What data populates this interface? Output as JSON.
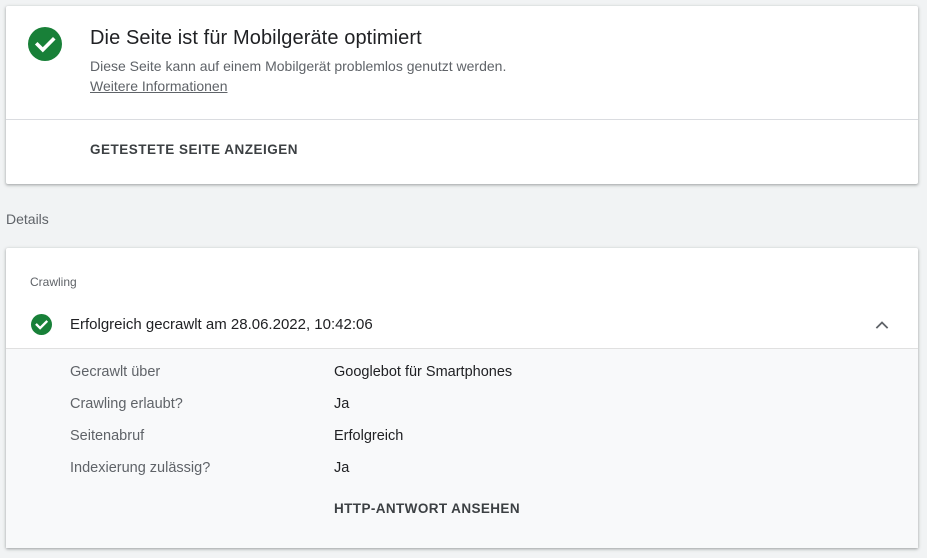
{
  "colors": {
    "success_green": "#188038",
    "background": "#f1f3f4",
    "card": "#ffffff",
    "detail_panel": "#f8f9fa"
  },
  "result": {
    "icon": "check-circle-icon",
    "title": "Die Seite ist für Mobilgeräte optimiert",
    "description": "Diese Seite kann auf einem Mobilgerät problemlos genutzt werden.",
    "more_info_link": "Weitere Informationen",
    "view_tested_page_button": "GETESTETE SEITE ANZEIGEN"
  },
  "details": {
    "label": "Details",
    "crawling": {
      "section_label": "Crawling",
      "status_icon": "check-circle-icon",
      "status": "Erfolgreich gecrawlt am 28.06.2022, 10:42:06",
      "expand_icon": "chevron-up-icon",
      "rows": [
        {
          "key": "Gecrawlt über",
          "value": "Googlebot für Smartphones"
        },
        {
          "key": "Crawling erlaubt?",
          "value": "Ja"
        },
        {
          "key": "Seitenabruf",
          "value": "Erfolgreich"
        },
        {
          "key": "Indexierung zulässig?",
          "value": "Ja"
        }
      ],
      "http_button": "HTTP-ANTWORT ANSEHEN"
    }
  }
}
